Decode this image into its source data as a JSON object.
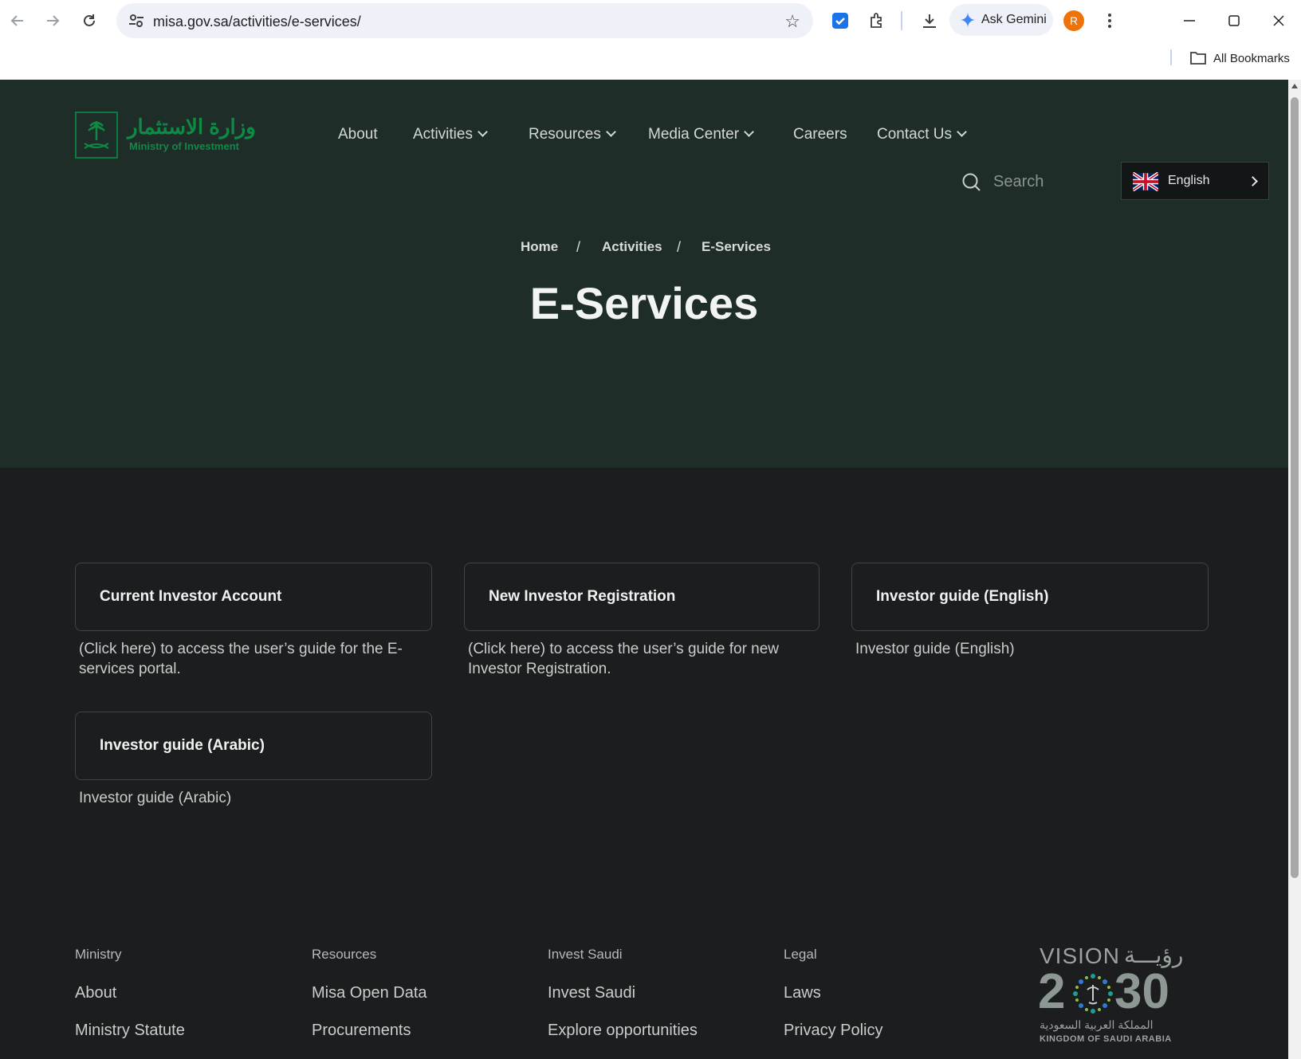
{
  "browser": {
    "url": "misa.gov.sa/activities/e-services/",
    "gemini_label": "Ask Gemini",
    "profile_initial": "R",
    "bookmarks_label": "All Bookmarks"
  },
  "header": {
    "logo_arabic": "وزارة الاستثمار",
    "logo_english": "Ministry of Investment",
    "nav": [
      "About",
      "Activities",
      "Resources",
      "Media Center",
      "Careers",
      "Contact Us"
    ],
    "search_placeholder": "Search",
    "language": "English"
  },
  "breadcrumb": [
    "Home",
    "Activities",
    "E-Services"
  ],
  "breadcrumb_separator": "/",
  "page_title": "E-Services",
  "cards": [
    {
      "title": "Current Investor Account",
      "description": "(Click here) to access the user’s guide for the E-services portal."
    },
    {
      "title": "New Investor Registration",
      "description": "(Click here) to access the user’s guide for new Investor Registration."
    },
    {
      "title": "Investor guide (English)",
      "description": "Investor guide (English)"
    },
    {
      "title": "Investor guide (Arabic)",
      "description": "Investor guide (Arabic)"
    }
  ],
  "footer": {
    "columns": [
      {
        "heading": "Ministry",
        "links": [
          "About",
          "Ministry Statute"
        ]
      },
      {
        "heading": "Resources",
        "links": [
          "Misa Open Data",
          "Procurements"
        ]
      },
      {
        "heading": "Invest Saudi",
        "links": [
          "Invest Saudi",
          "Explore opportunities"
        ]
      },
      {
        "heading": "Legal",
        "links": [
          "Laws",
          "Privacy Policy"
        ]
      }
    ],
    "vision_top": "VISION",
    "vision_arabic": "رؤيـــة",
    "vision_year_a": "2",
    "vision_year_b": "30",
    "vision_arabic_sub": "المملكة العربية السعودية",
    "vision_sub": "KINGDOM OF SAUDI ARABIA"
  },
  "colors": {
    "hero_bg": "#1f2d29",
    "content_bg": "#1b1d1f",
    "brand_green": "#0f8a45"
  }
}
